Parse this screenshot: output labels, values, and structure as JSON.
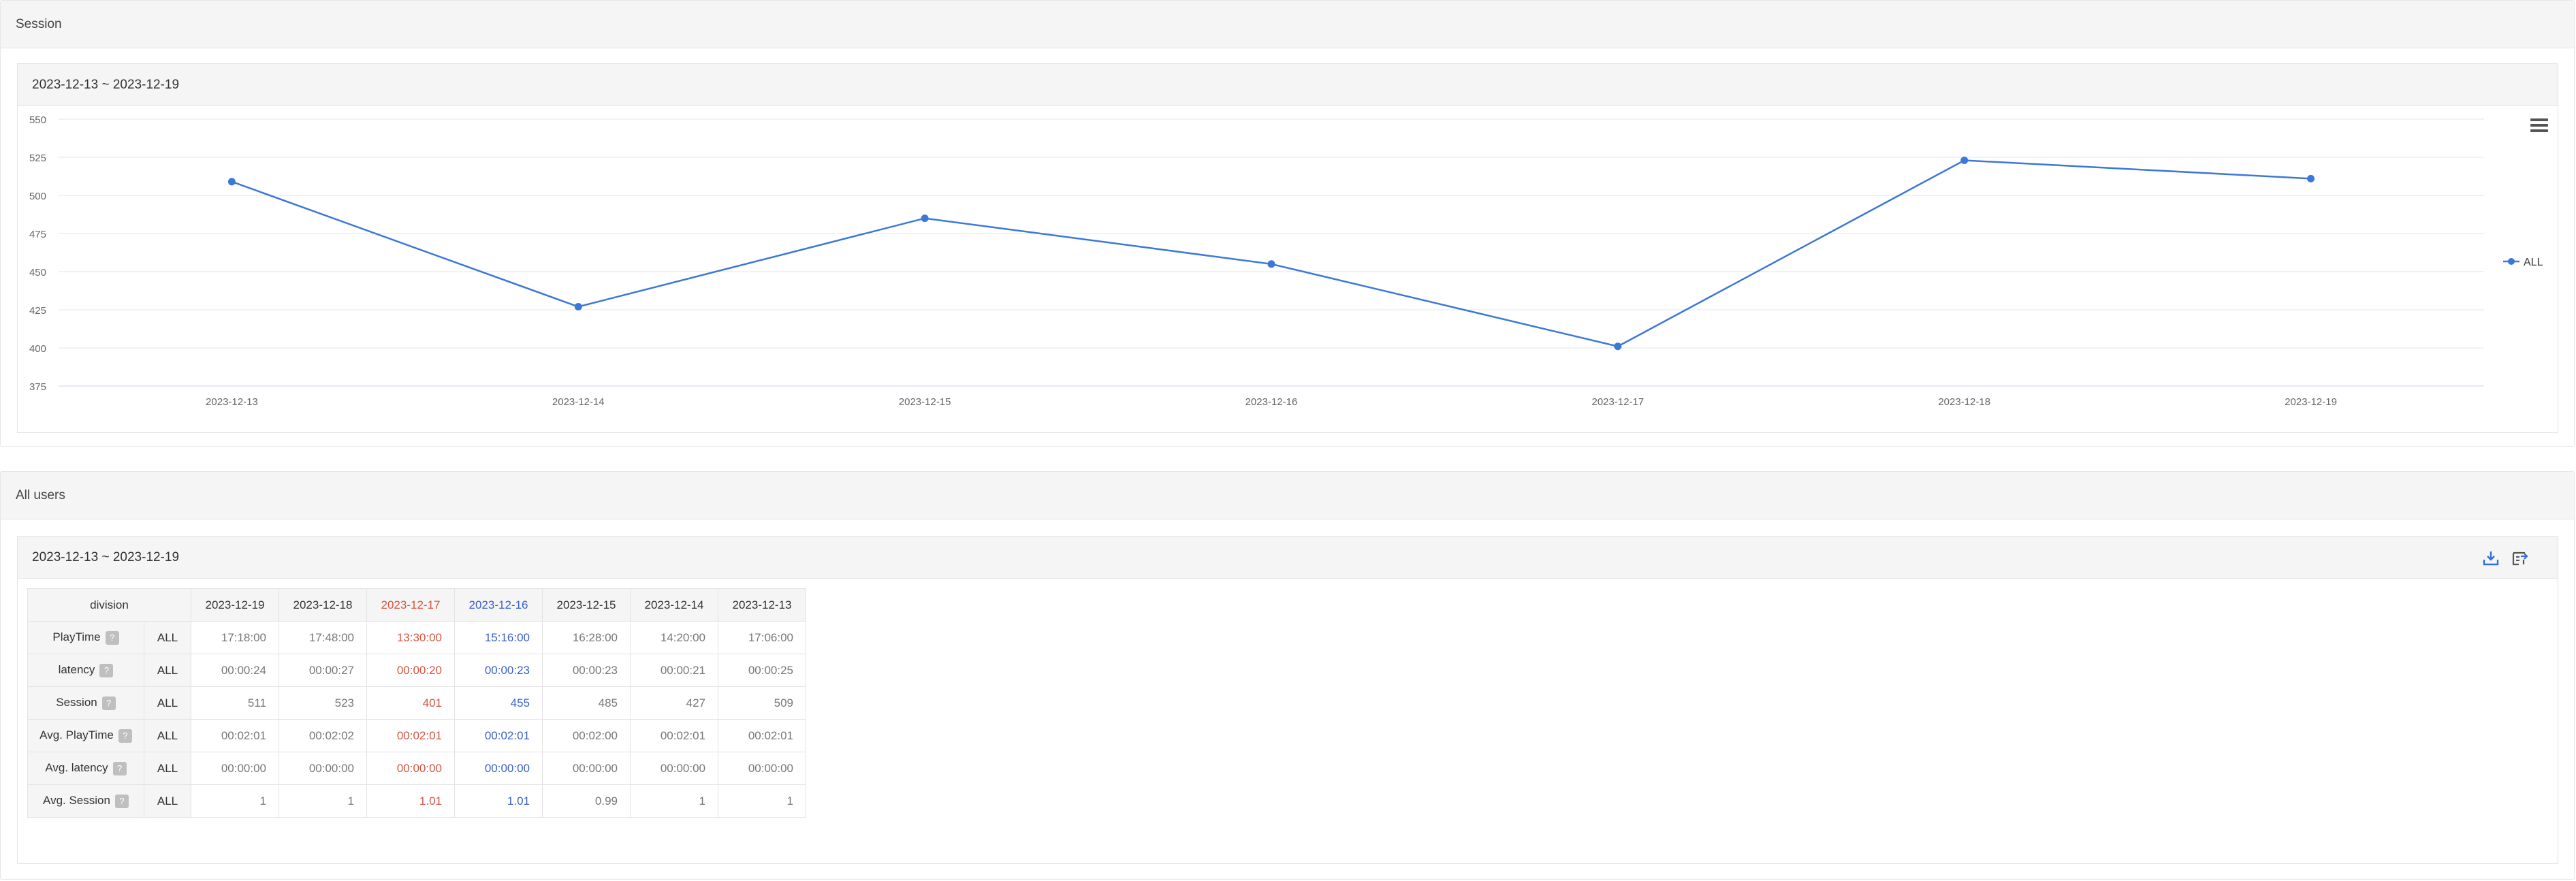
{
  "session_section": {
    "title": "Session",
    "chart_card": {
      "range": "2023-12-13 ~ 2023-12-19"
    }
  },
  "chart_data": {
    "type": "line",
    "x": [
      "2023-12-13",
      "2023-12-14",
      "2023-12-15",
      "2023-12-16",
      "2023-12-17",
      "2023-12-18",
      "2023-12-19"
    ],
    "series": [
      {
        "name": "ALL",
        "values": [
          509,
          427,
          485,
          455,
          401,
          523,
          511
        ],
        "color": "#3c78d8"
      }
    ],
    "ylim": [
      375,
      550
    ],
    "yticks": [
      375,
      400,
      425,
      450,
      475,
      500,
      525,
      550
    ],
    "grid": true,
    "legend": "right",
    "title": "",
    "xlabel": "",
    "ylabel": ""
  },
  "users_section": {
    "title": "All users",
    "table_card": {
      "range": "2023-12-13 ~ 2023-12-19",
      "icons": [
        "download-icon",
        "export-icon"
      ]
    },
    "table": {
      "header_label": "division",
      "dates": [
        "2023-12-19",
        "2023-12-18",
        "2023-12-17",
        "2023-12-16",
        "2023-12-15",
        "2023-12-14",
        "2023-12-13"
      ],
      "date_styles": [
        "",
        "",
        "red",
        "blue",
        "",
        "",
        ""
      ],
      "help_glyph": "?",
      "rows": [
        {
          "label": "PlayTime",
          "group": "ALL",
          "values": [
            "17:18:00",
            "17:48:00",
            "13:30:00",
            "15:16:00",
            "16:28:00",
            "14:20:00",
            "17:06:00"
          ]
        },
        {
          "label": "latency",
          "group": "ALL",
          "values": [
            "00:00:24",
            "00:00:27",
            "00:00:20",
            "00:00:23",
            "00:00:23",
            "00:00:21",
            "00:00:25"
          ]
        },
        {
          "label": "Session",
          "group": "ALL",
          "values": [
            "511",
            "523",
            "401",
            "455",
            "485",
            "427",
            "509"
          ]
        },
        {
          "label": "Avg. PlayTime",
          "group": "ALL",
          "values": [
            "00:02:01",
            "00:02:02",
            "00:02:01",
            "00:02:01",
            "00:02:00",
            "00:02:01",
            "00:02:01"
          ]
        },
        {
          "label": "Avg. latency",
          "group": "ALL",
          "values": [
            "00:00:00",
            "00:00:00",
            "00:00:00",
            "00:00:00",
            "00:00:00",
            "00:00:00",
            "00:00:00"
          ]
        },
        {
          "label": "Avg. Session",
          "group": "ALL",
          "values": [
            "1",
            "1",
            "1.01",
            "1.01",
            "0.99",
            "1",
            "1"
          ]
        }
      ]
    }
  }
}
